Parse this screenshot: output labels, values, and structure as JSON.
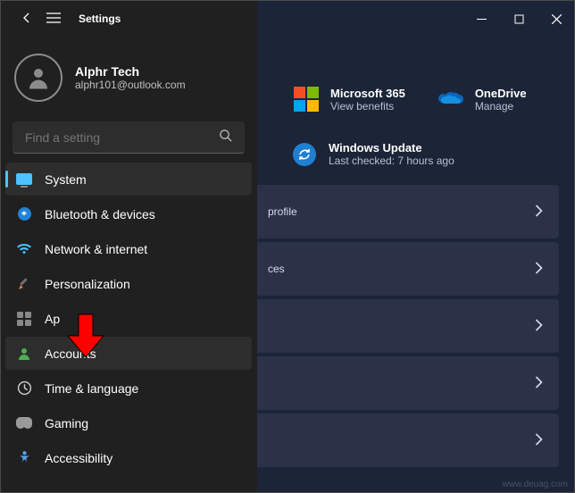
{
  "titlebar": {
    "title": "Settings"
  },
  "profile": {
    "name": "Alphr Tech",
    "email": "alphr101@outlook.com"
  },
  "search": {
    "placeholder": "Find a setting"
  },
  "nav": {
    "system": "System",
    "bluetooth": "Bluetooth & devices",
    "network": "Network & internet",
    "personalization": "Personalization",
    "apps": "Ap",
    "accounts": "Accounts",
    "time": "Time & language",
    "gaming": "Gaming",
    "accessibility": "Accessibility"
  },
  "main": {
    "ms365": {
      "title": "Microsoft 365",
      "sub": "View benefits"
    },
    "onedrive": {
      "title": "OneDrive",
      "sub": "Manage"
    },
    "update": {
      "title": "Windows Update",
      "sub": "Last checked: 7 hours ago"
    },
    "cards": {
      "profile": "profile",
      "ces": "ces"
    }
  },
  "watermark": "www.deuag.com"
}
